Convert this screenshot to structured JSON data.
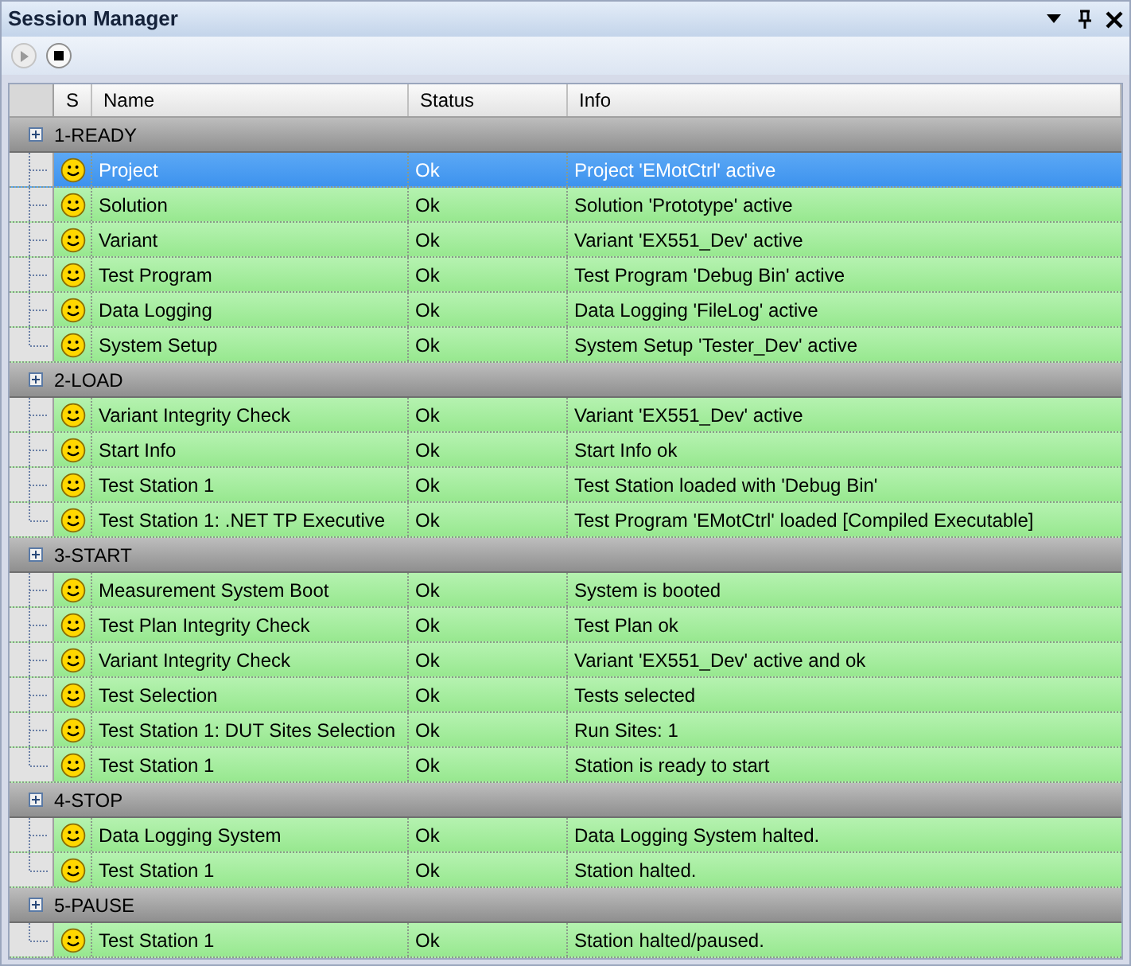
{
  "window": {
    "title": "Session Manager"
  },
  "toolbar": [
    {
      "kind": "play",
      "disabled": true
    },
    {
      "kind": "stop",
      "disabled": false
    }
  ],
  "table": {
    "columns": [
      "S",
      "Name",
      "Status",
      "Info"
    ],
    "groups": [
      {
        "label": "1-READY",
        "rows": [
          {
            "name": "Project",
            "status": "Ok",
            "info": "Project 'EMotCtrl' active",
            "selected": true
          },
          {
            "name": "Solution",
            "status": "Ok",
            "info": "Solution 'Prototype' active",
            "selected": false
          },
          {
            "name": "Variant",
            "status": "Ok",
            "info": "Variant 'EX551_Dev' active",
            "selected": false
          },
          {
            "name": "Test Program",
            "status": "Ok",
            "info": "Test Program 'Debug Bin' active",
            "selected": false
          },
          {
            "name": "Data Logging",
            "status": "Ok",
            "info": "Data Logging 'FileLog' active",
            "selected": false
          },
          {
            "name": "System Setup",
            "status": "Ok",
            "info": "System Setup 'Tester_Dev' active",
            "selected": false
          }
        ]
      },
      {
        "label": "2-LOAD",
        "rows": [
          {
            "name": "Variant Integrity Check",
            "status": "Ok",
            "info": "Variant 'EX551_Dev' active",
            "selected": false
          },
          {
            "name": "Start Info",
            "status": "Ok",
            "info": "Start Info ok",
            "selected": false
          },
          {
            "name": "Test Station 1",
            "status": "Ok",
            "info": "Test Station loaded with 'Debug Bin'",
            "selected": false
          },
          {
            "name": "Test Station 1: .NET TP Executive",
            "status": "Ok",
            "info": "Test Program 'EMotCtrl' loaded [Compiled Executable]",
            "selected": false
          }
        ]
      },
      {
        "label": "3-START",
        "rows": [
          {
            "name": "Measurement System Boot",
            "status": "Ok",
            "info": "System is booted",
            "selected": false
          },
          {
            "name": "Test Plan Integrity Check",
            "status": "Ok",
            "info": "Test Plan ok",
            "selected": false
          },
          {
            "name": "Variant Integrity Check",
            "status": "Ok",
            "info": "Variant 'EX551_Dev' active and ok",
            "selected": false
          },
          {
            "name": "Test Selection",
            "status": "Ok",
            "info": "Tests selected",
            "selected": false
          },
          {
            "name": "Test Station 1: DUT Sites Selection",
            "status": "Ok",
            "info": "Run Sites: 1",
            "selected": false
          },
          {
            "name": "Test Station 1",
            "status": "Ok",
            "info": "Station is ready to start",
            "selected": false
          }
        ]
      },
      {
        "label": "4-STOP",
        "rows": [
          {
            "name": "Data Logging System",
            "status": "Ok",
            "info": "Data Logging System halted.",
            "selected": false
          },
          {
            "name": "Test Station 1",
            "status": "Ok",
            "info": "Station halted.",
            "selected": false
          }
        ]
      },
      {
        "label": "5-PAUSE",
        "rows": [
          {
            "name": "Test Station 1",
            "status": "Ok",
            "info": "Station halted/paused.",
            "selected": false
          }
        ]
      }
    ]
  }
}
